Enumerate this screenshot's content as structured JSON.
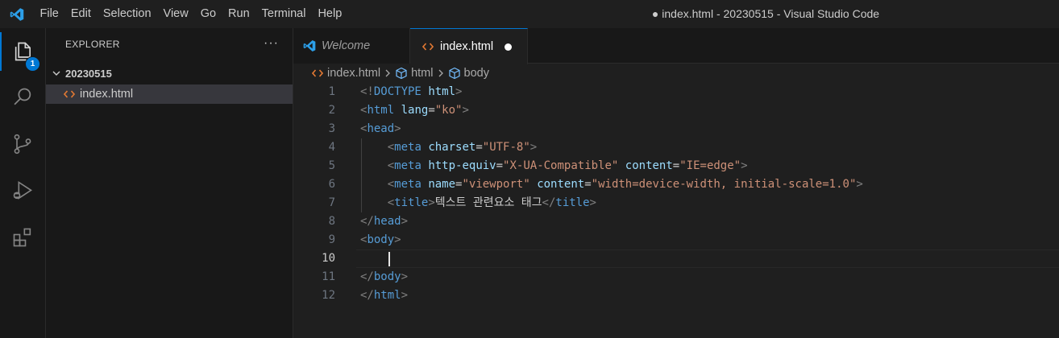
{
  "titlebar": {
    "menu": [
      "File",
      "Edit",
      "Selection",
      "View",
      "Go",
      "Run",
      "Terminal",
      "Help"
    ],
    "title": "● index.html - 20230515 - Visual Studio Code"
  },
  "activity_bar": {
    "items": [
      "explorer-icon",
      "search-icon",
      "source-control-icon",
      "run-debug-icon",
      "extensions-icon"
    ],
    "explorer_badge": "1"
  },
  "sidebar": {
    "header": "EXPLORER",
    "more": "···",
    "folder": "20230515",
    "files": [
      {
        "name": "index.html",
        "icon": "html-file-icon"
      }
    ]
  },
  "tabs": [
    {
      "label": "Welcome",
      "icon": "vscode-logo-icon",
      "active": false
    },
    {
      "label": "index.html",
      "icon": "html-file-icon",
      "active": true,
      "dirty": true
    }
  ],
  "breadcrumb": [
    "index.html",
    "html",
    "body"
  ],
  "editor": {
    "current_line": 10,
    "lines": [
      {
        "n": "1",
        "tokens": [
          [
            "b",
            "<!"
          ],
          [
            "t",
            "DOCTYPE"
          ],
          [
            "x",
            " "
          ],
          [
            "a",
            "html"
          ],
          [
            "b",
            ">"
          ]
        ]
      },
      {
        "n": "2",
        "tokens": [
          [
            "b",
            "<"
          ],
          [
            "t",
            "html"
          ],
          [
            "x",
            " "
          ],
          [
            "a",
            "lang"
          ],
          [
            "e",
            "="
          ],
          [
            "s",
            "\"ko\""
          ],
          [
            "b",
            ">"
          ]
        ]
      },
      {
        "n": "3",
        "tokens": [
          [
            "b",
            "<"
          ],
          [
            "t",
            "head"
          ],
          [
            "b",
            ">"
          ]
        ]
      },
      {
        "n": "4",
        "tokens": [
          [
            "x",
            "    "
          ],
          [
            "b",
            "<"
          ],
          [
            "t",
            "meta"
          ],
          [
            "x",
            " "
          ],
          [
            "a",
            "charset"
          ],
          [
            "e",
            "="
          ],
          [
            "s",
            "\"UTF-8\""
          ],
          [
            "b",
            ">"
          ]
        ]
      },
      {
        "n": "5",
        "tokens": [
          [
            "x",
            "    "
          ],
          [
            "b",
            "<"
          ],
          [
            "t",
            "meta"
          ],
          [
            "x",
            " "
          ],
          [
            "a",
            "http-equiv"
          ],
          [
            "e",
            "="
          ],
          [
            "s",
            "\"X-UA-Compatible\""
          ],
          [
            "x",
            " "
          ],
          [
            "a",
            "content"
          ],
          [
            "e",
            "="
          ],
          [
            "s",
            "\"IE=edge\""
          ],
          [
            "b",
            ">"
          ]
        ]
      },
      {
        "n": "6",
        "tokens": [
          [
            "x",
            "    "
          ],
          [
            "b",
            "<"
          ],
          [
            "t",
            "meta"
          ],
          [
            "x",
            " "
          ],
          [
            "a",
            "name"
          ],
          [
            "e",
            "="
          ],
          [
            "s",
            "\"viewport\""
          ],
          [
            "x",
            " "
          ],
          [
            "a",
            "content"
          ],
          [
            "e",
            "="
          ],
          [
            "s",
            "\"width=device-width, initial-scale=1.0\""
          ],
          [
            "b",
            ">"
          ]
        ]
      },
      {
        "n": "7",
        "tokens": [
          [
            "x",
            "    "
          ],
          [
            "b",
            "<"
          ],
          [
            "t",
            "title"
          ],
          [
            "b",
            ">"
          ],
          [
            "x",
            "텍스트 관련요소 태그"
          ],
          [
            "b",
            "</"
          ],
          [
            "t",
            "title"
          ],
          [
            "b",
            ">"
          ]
        ]
      },
      {
        "n": "8",
        "tokens": [
          [
            "b",
            "</"
          ],
          [
            "t",
            "head"
          ],
          [
            "b",
            ">"
          ]
        ]
      },
      {
        "n": "9",
        "tokens": [
          [
            "b",
            "<"
          ],
          [
            "t",
            "body"
          ],
          [
            "b",
            ">"
          ]
        ]
      },
      {
        "n": "10",
        "tokens": [
          [
            "x",
            "    "
          ]
        ]
      },
      {
        "n": "11",
        "tokens": [
          [
            "b",
            "</"
          ],
          [
            "t",
            "body"
          ],
          [
            "b",
            ">"
          ]
        ]
      },
      {
        "n": "12",
        "tokens": [
          [
            "b",
            "</"
          ],
          [
            "t",
            "html"
          ],
          [
            "b",
            ">"
          ]
        ]
      }
    ]
  },
  "colors": {
    "accent": "#0078d4",
    "tag": "#569cd6",
    "attribute": "#9cdcfe",
    "string": "#ce9178",
    "html_icon": "#e37933"
  }
}
